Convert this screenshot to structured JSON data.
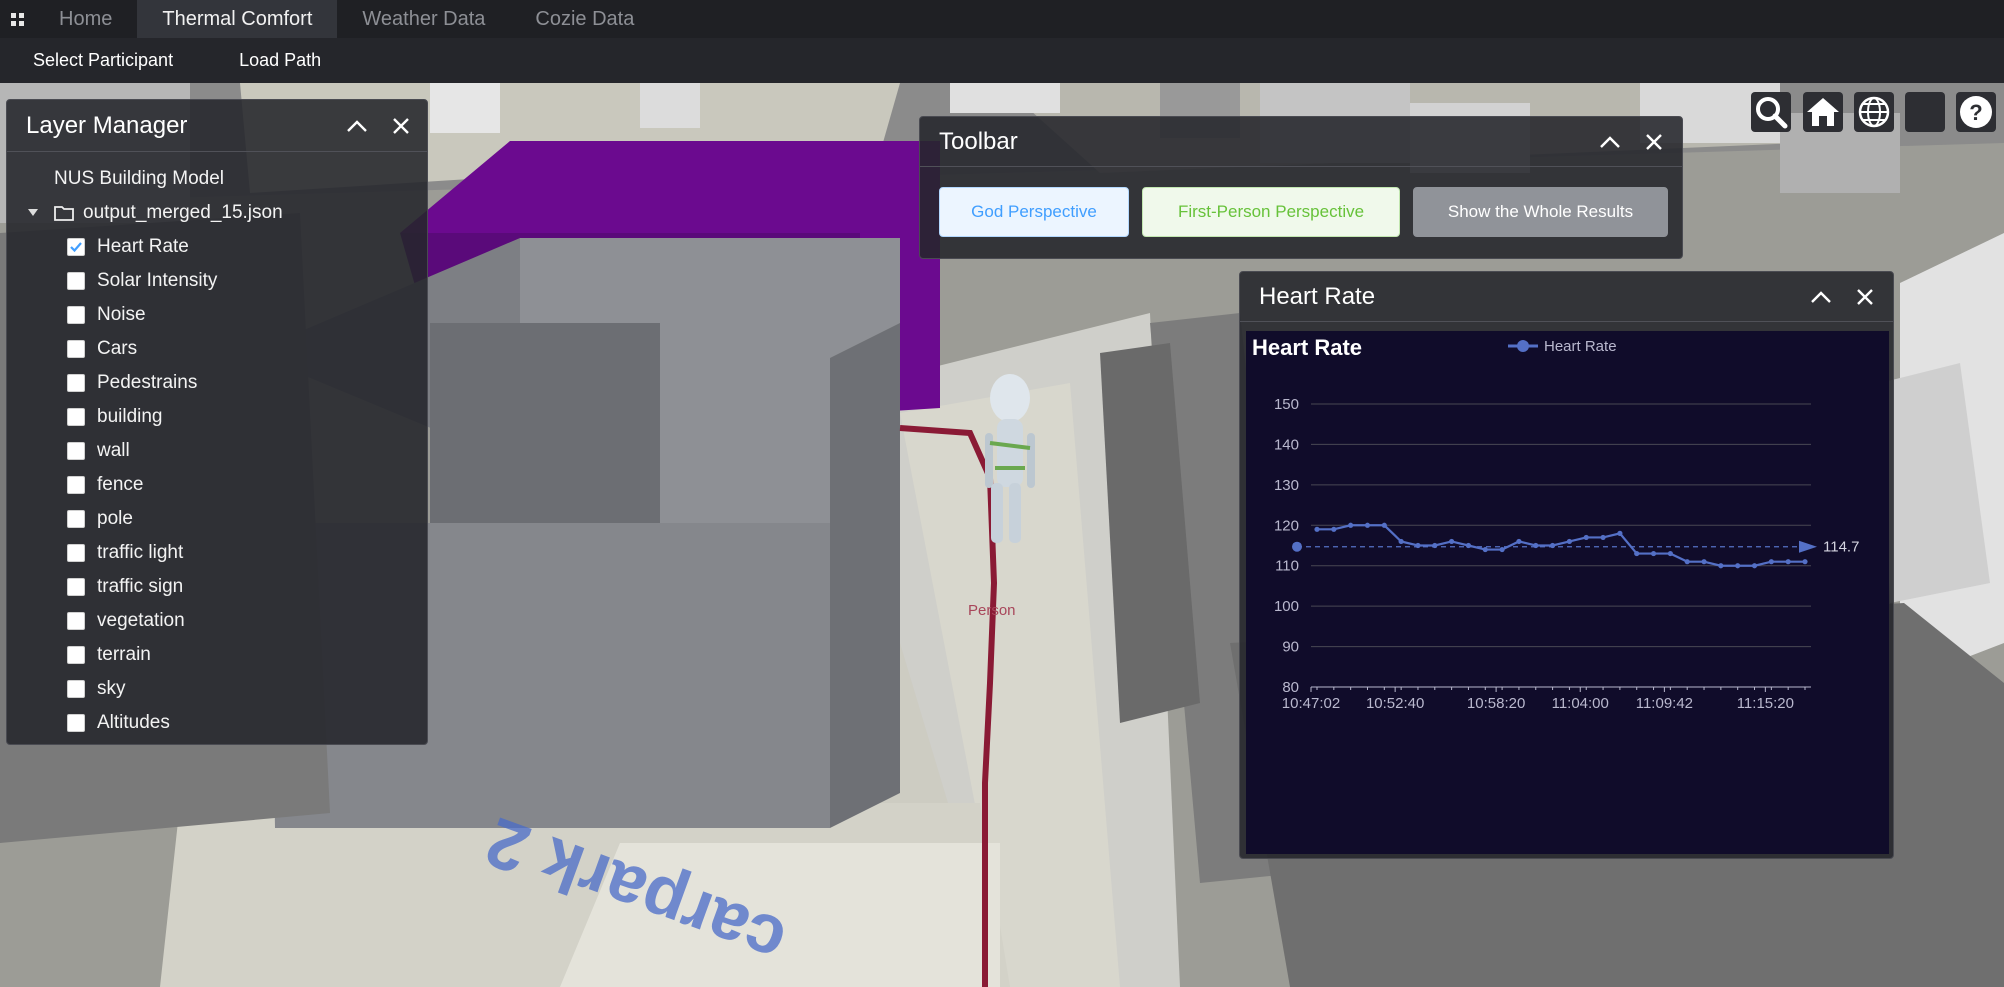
{
  "tabs": [
    "Home",
    "Thermal Comfort",
    "Weather Data",
    "Cozie Data"
  ],
  "active_tab": "Thermal Comfort",
  "subnav": [
    "Select Participant",
    "Load Path"
  ],
  "scene": {
    "person_label": "Person",
    "ground_text": "carpark 2"
  },
  "top_icons": [
    "search-icon",
    "home-icon",
    "globe-icon",
    "blank-icon",
    "help-icon"
  ],
  "layer_manager": {
    "title": "Layer Manager",
    "root": "NUS Building Model",
    "folder": "output_merged_15.json",
    "layers": [
      {
        "label": "Heart Rate",
        "checked": true
      },
      {
        "label": "Solar Intensity",
        "checked": false
      },
      {
        "label": "Noise",
        "checked": false
      },
      {
        "label": "Cars",
        "checked": false
      },
      {
        "label": "Pedestrains",
        "checked": false
      },
      {
        "label": "building",
        "checked": false
      },
      {
        "label": "wall",
        "checked": false
      },
      {
        "label": "fence",
        "checked": false
      },
      {
        "label": "pole",
        "checked": false
      },
      {
        "label": "traffic light",
        "checked": false
      },
      {
        "label": "traffic sign",
        "checked": false
      },
      {
        "label": "vegetation",
        "checked": false
      },
      {
        "label": "terrain",
        "checked": false
      },
      {
        "label": "sky",
        "checked": false
      },
      {
        "label": "Altitudes",
        "checked": false
      }
    ]
  },
  "toolbar": {
    "title": "Toolbar",
    "god_label": "God Perspective",
    "first_person_label": "First-Person Perspective",
    "whole_label": "Show the Whole Results"
  },
  "heart_rate_panel": {
    "title": "Heart Rate"
  },
  "colors": {
    "accent": "#5470c6",
    "chart_bg": "#100c2a",
    "purple_building": "#6b0a8f",
    "path_line": "#8a1a35"
  },
  "chart_data": {
    "type": "line",
    "title": "Heart Rate",
    "series": [
      {
        "name": "Heart Rate",
        "values": [
          119,
          119,
          120,
          120,
          120,
          116,
          115,
          115,
          116,
          115,
          114,
          114,
          116,
          115,
          115,
          116,
          117,
          117,
          118,
          113,
          113,
          113,
          111,
          111,
          110,
          110,
          110,
          111,
          111,
          111
        ]
      }
    ],
    "x_tick_labels": [
      "10:47:02",
      "10:52:40",
      "10:58:20",
      "11:04:00",
      "11:09:42",
      "11:15:20"
    ],
    "y_ticks": [
      80,
      90,
      100,
      110,
      120,
      130,
      140,
      150
    ],
    "ylim": [
      80,
      150
    ],
    "mark_line": {
      "type": "average",
      "value": 114.7,
      "label": "114.7"
    },
    "legend_position": "top-center",
    "grid": true
  }
}
